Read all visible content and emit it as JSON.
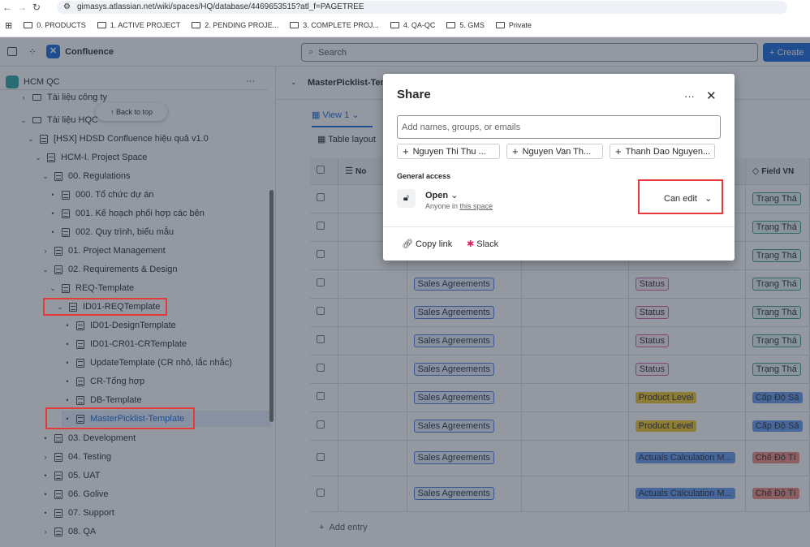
{
  "browser": {
    "url": "gimasys.atlassian.net/wiki/spaces/HQ/database/4469653515?atl_f=PAGETREE",
    "bookmarks": [
      "0. PRODUCTS",
      "1. ACTIVE PROJECT",
      "2. PENDING PROJE...",
      "3. COMPLETE PROJ...",
      "4. QA-QC",
      "5. GMS",
      "Private"
    ]
  },
  "app": {
    "name": "Confluence",
    "search_placeholder": "Search",
    "create_label": "+ Create"
  },
  "sidebar": {
    "space": "HCM QC",
    "back_to_top": "Back to top",
    "items": [
      {
        "label": "Tài liệu công ty",
        "chev": "›",
        "type": "folder",
        "lvl": 1
      },
      {
        "label": "Tài liệu HQC",
        "chev": "⌄",
        "type": "folder",
        "lvl": 1
      },
      {
        "label": "[HSX] HDSD Confluence hiệu quả v1.0",
        "chev": "⌄",
        "type": "page",
        "lvl": 2
      },
      {
        "label": "HCM-I. Project Space",
        "chev": "⌄",
        "type": "page",
        "lvl": 3
      },
      {
        "label": "00. Regulations",
        "chev": "⌄",
        "type": "page",
        "lvl": 4
      },
      {
        "label": "000. Tổ chức dự án",
        "chev": "•",
        "type": "page",
        "lvl": 5
      },
      {
        "label": "001. Kế hoạch phối hợp các bên",
        "chev": "•",
        "type": "page",
        "lvl": 5
      },
      {
        "label": "002. Quy trình, biểu mẫu",
        "chev": "•",
        "type": "page",
        "lvl": 5
      },
      {
        "label": "01. Project Management",
        "chev": "›",
        "type": "page",
        "lvl": 4
      },
      {
        "label": "02. Requirements & Design",
        "chev": "⌄",
        "type": "page",
        "lvl": 4
      },
      {
        "label": "REQ-Template",
        "chev": "⌄",
        "type": "page",
        "lvl": 5
      },
      {
        "label": "ID01-REQTemplate",
        "chev": "⌄",
        "type": "page",
        "lvl": 6
      },
      {
        "label": "ID01-DesignTemplate",
        "chev": "•",
        "type": "page",
        "lvl": 7
      },
      {
        "label": "ID01-CR01-CRTemplate",
        "chev": "•",
        "type": "page",
        "lvl": 7
      },
      {
        "label": "UpdateTemplate (CR nhỏ, lắc nhắc)",
        "chev": "•",
        "type": "db",
        "lvl": 7
      },
      {
        "label": "CR-Tổng hợp",
        "chev": "•",
        "type": "page",
        "lvl": 7
      },
      {
        "label": "DB-Template",
        "chev": "•",
        "type": "db",
        "lvl": 7
      },
      {
        "label": "MasterPicklist-Template",
        "chev": "•",
        "type": "db",
        "lvl": 7,
        "selected": true
      },
      {
        "label": "03. Development",
        "chev": "•",
        "type": "page",
        "lvl": 4
      },
      {
        "label": "04. Testing",
        "chev": "›",
        "type": "page",
        "lvl": 4
      },
      {
        "label": "05. UAT",
        "chev": "•",
        "type": "page",
        "lvl": 4
      },
      {
        "label": "06. Golive",
        "chev": "•",
        "type": "page",
        "lvl": 4
      },
      {
        "label": "07. Support",
        "chev": "•",
        "type": "page",
        "lvl": 4
      },
      {
        "label": "08. QA",
        "chev": "›",
        "type": "page",
        "lvl": 4
      }
    ]
  },
  "main": {
    "title": "MasterPicklist-Tem",
    "view": "View 1",
    "layout": "Table layout",
    "columns": [
      "No",
      "Field VN"
    ],
    "rows": [
      {
        "c3": "",
        "c5": "",
        "c6": "Trạng Thá",
        "c6c": "green"
      },
      {
        "c3": "",
        "c5": "",
        "c6": "Trạng Thá",
        "c6c": "green"
      },
      {
        "c3": "",
        "c5": "",
        "c6": "Trạng Thá",
        "c6c": "green"
      },
      {
        "c3": "Sales Agreements",
        "c5": "Status",
        "c5c": "pink",
        "c6": "Trạng Thá",
        "c6c": "green"
      },
      {
        "c3": "Sales Agreements",
        "c5": "Status",
        "c5c": "pink",
        "c6": "Trạng Thá",
        "c6c": "green"
      },
      {
        "c3": "Sales Agreements",
        "c5": "Status",
        "c5c": "pink",
        "c6": "Trạng Thá",
        "c6c": "green"
      },
      {
        "c3": "Sales Agreements",
        "c5": "Status",
        "c5c": "pink",
        "c6": "Trạng Thá",
        "c6c": "green"
      },
      {
        "c3": "Sales Agreements",
        "c5": "Product Level",
        "c5c": "yellow",
        "c6": "Cấp Độ Sả",
        "c6c": "solidblue"
      },
      {
        "c3": "Sales Agreements",
        "c5": "Product Level",
        "c5c": "yellow",
        "c6": "Cấp Độ Sả",
        "c6c": "solidblue"
      },
      {
        "c3": "Sales Agreements",
        "c5": "Actuals Calculation M...",
        "c5c": "solidblue",
        "c6": "Chế Độ Tí",
        "c6c": "red"
      },
      {
        "c3": "Sales Agreements",
        "c5": "Actuals Calculation M...",
        "c5c": "solidblue",
        "c6": "Chế Độ Tí",
        "c6c": "red"
      }
    ],
    "add_entry": "Add entry"
  },
  "share": {
    "title": "Share",
    "input_placeholder": "Add names, groups, or emails",
    "suggestions": [
      "Nguyen Thi Thu ...",
      "Nguyen Van Th...",
      "Thanh Dao Nguyen..."
    ],
    "general_access": "General access",
    "access": "Open",
    "access_sub": "Anyone in ",
    "access_link": "this space",
    "permission": "Can edit",
    "copy_link": "Copy link",
    "slack": "Slack"
  }
}
